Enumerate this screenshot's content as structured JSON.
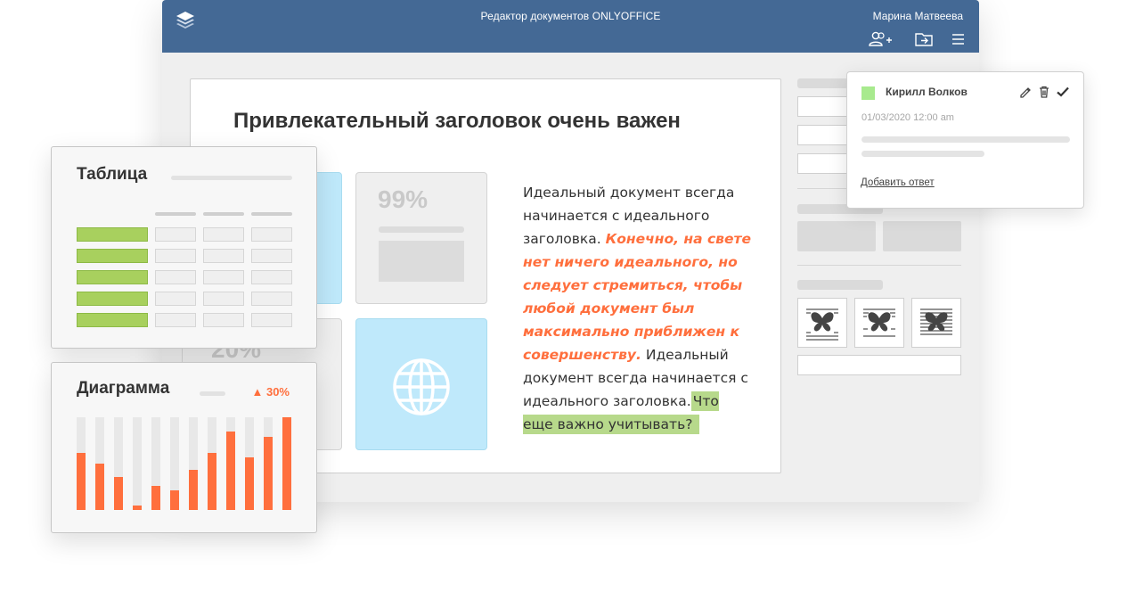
{
  "titlebar": {
    "app_title": "Редактор документов ONLYOFFICE",
    "user_name": "Марина Матвеева",
    "icons": [
      "layers-logo-icon",
      "add-user-icon",
      "open-folder-icon",
      "menu-icon"
    ]
  },
  "document": {
    "heading": "Привлекательный заголовок очень важен",
    "tile_top_pct": "99%",
    "tile_bottom_pct": "20%",
    "paragraph": {
      "part1": "Идеальный документ всегда начинается с идеального заголовка. ",
      "emphasis": "Конечно, на свете нет ничего идеального, но следует стремиться, чтобы любой документ был максимально приближен к совершенству.",
      "part2": " Идеальный документ всегда начинается с идеального заголовка.",
      "highlight": "Что еще важно учитывать?"
    },
    "accent_color": "#ff6f3d",
    "highlight_color": "#b7d98b"
  },
  "comment": {
    "author": "Кирилл Волков",
    "datetime": "01/03/2020  12:00 am",
    "reply_link": "Добавить ответ",
    "author_color": "#a8ea8e"
  },
  "table_card": {
    "title": "Таблица",
    "rows": 5,
    "accent_color": "#a8d05e"
  },
  "chart_card": {
    "title": "Диаграмма",
    "change": "30%",
    "trend": "up"
  },
  "chart_data": {
    "type": "bar",
    "values": [
      62,
      50,
      36,
      5,
      26,
      21,
      43,
      62,
      85,
      57,
      79,
      100
    ],
    "ylim": [
      0,
      100
    ],
    "color": "#ff6f3d",
    "track_color": "#e8e8e8"
  },
  "brand_color": "#446995"
}
